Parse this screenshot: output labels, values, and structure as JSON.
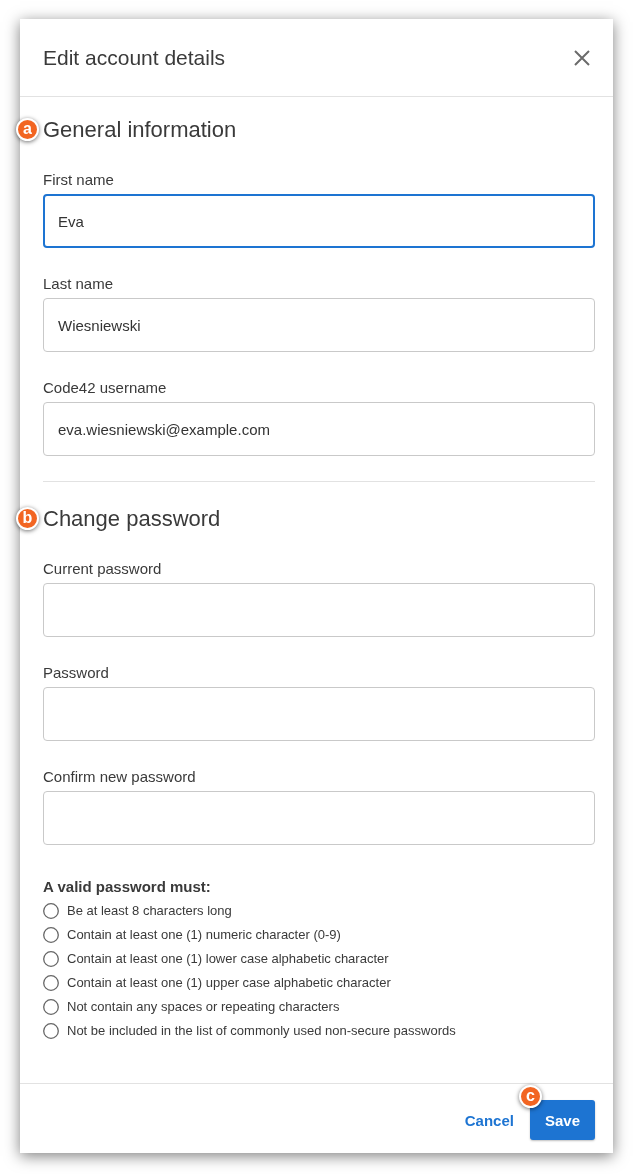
{
  "dialog": {
    "title": "Edit account details"
  },
  "sections": [
    {
      "heading": "General information",
      "callout": "a",
      "fields": [
        {
          "label": "First name",
          "value": "Eva",
          "focused": true
        },
        {
          "label": "Last name",
          "value": "Wiesniewski",
          "focused": false
        },
        {
          "label": "Code42 username",
          "value": "eva.wiesniewski@example.com",
          "focused": false
        }
      ]
    },
    {
      "heading": "Change password",
      "callout": "b",
      "fields": [
        {
          "label": "Current password",
          "focused": false
        },
        {
          "label": "Password",
          "focused": false
        },
        {
          "label": "Confirm new password",
          "focused": false
        }
      ]
    }
  ],
  "requirements": {
    "heading": "A valid password must:",
    "items": [
      {
        "text": "Be at least 8 characters long",
        "met": false
      },
      {
        "text": "Contain at least one (1) numeric character (0-9)",
        "met": false
      },
      {
        "text": "Contain at least one (1) lower case alphabetic character",
        "met": false
      },
      {
        "text": "Contain at least one (1) upper case alphabetic character",
        "met": false
      },
      {
        "text": "Not contain any spaces or repeating characters",
        "met": false
      },
      {
        "text": "Not be included in the list of commonly used non-secure passwords",
        "met": false
      }
    ]
  },
  "footer": {
    "buttons": [
      {
        "label": "Cancel",
        "kind": "link"
      },
      {
        "label": "Save",
        "kind": "primary",
        "callout": "c"
      }
    ]
  }
}
